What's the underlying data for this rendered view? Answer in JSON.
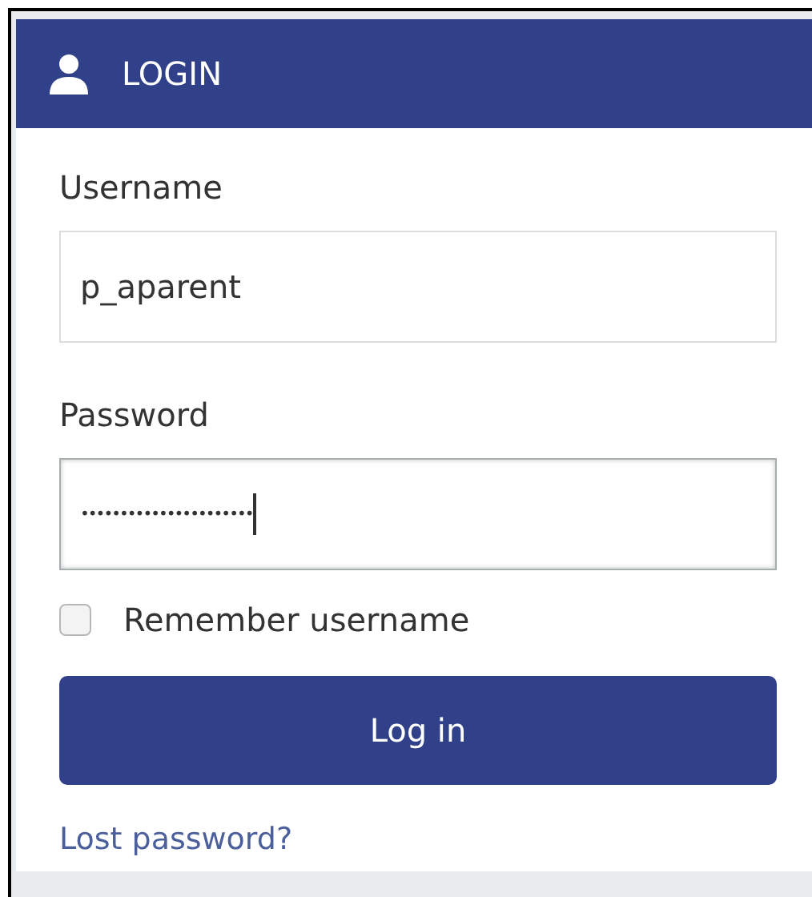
{
  "header": {
    "title": "LOGIN"
  },
  "fields": [
    {
      "label": "Username",
      "value": "p_aparent",
      "focused": false
    },
    {
      "label": "Password",
      "value": "••••••••••••••••••••••",
      "focused": true
    }
  ],
  "remember": {
    "label": "Remember username",
    "checked": false
  },
  "submit": {
    "label": "Log in"
  },
  "link": {
    "label": "Lost password?"
  }
}
